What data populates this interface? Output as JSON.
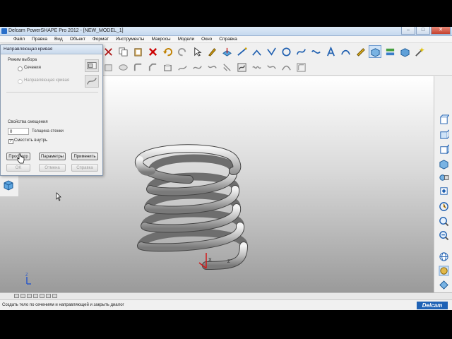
{
  "window": {
    "title": "Delcam PowerSHAPE Pro 2012 - [NEW_MODEL_1]",
    "minimize": "–",
    "maximize": "□",
    "close": "✕"
  },
  "menu": [
    "Файл",
    "Правка",
    "Вид",
    "Объект",
    "Формат",
    "Инструменты",
    "Макросы",
    "Модели",
    "Окно",
    "Справка"
  ],
  "dialog": {
    "title": "Направляющая кривая",
    "mode_group": "Режим выбора",
    "radio_sections": "Сечения",
    "radio_guide": "Направляющая кривая",
    "offset_group": "Свойства смещения",
    "thickness_value": "0",
    "thickness_label": "Толщина стенки",
    "offset_inside_label": "Сместить внутрь",
    "offset_inside_checked": true,
    "btn_preview": "Просмотр",
    "btn_params": "Параметры",
    "btn_apply": "Применить",
    "btn_ok": "OK",
    "btn_cancel": "Отмена",
    "btn_help": "Справка"
  },
  "viewport": {
    "axis_x_label": "X",
    "axis_z_label": "Z",
    "triad_label": "Z"
  },
  "status": {
    "text": "Создать тело по сечениям и направляющей и закрыть диалог",
    "brand": "Delcam"
  },
  "colors": {
    "accent": "#1f62b5",
    "active_toolbar": "#cfe3f7",
    "axis_red": "#d11a1a"
  }
}
